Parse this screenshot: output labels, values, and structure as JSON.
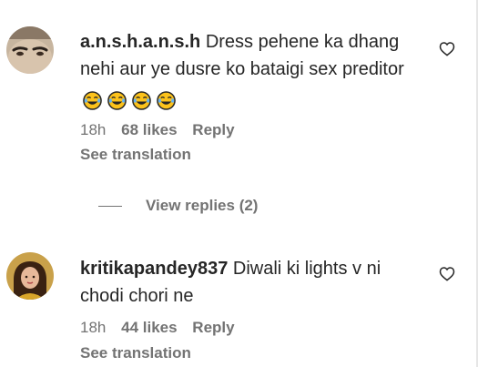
{
  "comments": [
    {
      "username": "a.n.s.h.a.n.s.h",
      "text": "Dress pehene ka dhang nehi aur ye dusre ko bataigi sex preditor",
      "emojis": [
        "😂",
        "😂",
        "😂",
        "😂"
      ],
      "time": "18h",
      "likes": "68 likes",
      "reply_label": "Reply",
      "translation_label": "See translation",
      "avatar_icon": "user-avatar-icon",
      "like_icon": "heart-outline-icon"
    },
    {
      "username": "kritikapandey837",
      "text": "Diwali ki lights v ni chodi chori ne",
      "time": "18h",
      "likes": "44 likes",
      "reply_label": "Reply",
      "translation_label": "See translation",
      "avatar_icon": "user-avatar-icon",
      "like_icon": "heart-outline-icon"
    }
  ],
  "view_replies": {
    "label": "View replies (2)"
  },
  "colors": {
    "text": "#262626",
    "secondary": "#737373",
    "background": "#ffffff"
  }
}
